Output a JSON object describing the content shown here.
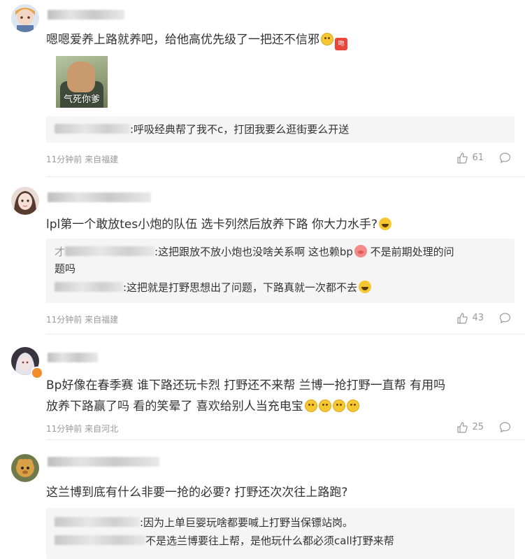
{
  "comments": [
    {
      "text": "嗯嗯爱养上路就养吧，给他高优先级了一把还不信邪",
      "sticker_caption": "气死你爹",
      "badge_emoji": "吻",
      "replies": [
        {
          "text": ":呼吸经典帮了我不c，打团我要么逛街要么开送"
        }
      ],
      "time": "11分钟前 来自福建",
      "likes": "61"
    },
    {
      "text": "lpl第一个敢放tes小炮的队伍 选卡列然后放养下路 你大力水手?",
      "replies": [
        {
          "prefix": "才",
          "text": ":这把跟放不放小炮也没啥关系啊 这也赖bp",
          "text_after": " 不是前期处理的问",
          "text_line2": "题吗"
        },
        {
          "text": ":这把就是打野思想出了问题，下路真就一次都不去"
        }
      ],
      "time": "11分钟前 来自福建",
      "likes": "43"
    },
    {
      "text_line1": "Bp好像在春季赛 谁下路还玩卡烈 打野还不来帮 兰博一抢打野一直帮 有用吗",
      "text_line2": "放养下路赢了吗 看的笑晕了 喜欢给别人当充电宝",
      "time": "11分钟前 来自河北",
      "likes": "25"
    },
    {
      "text": "这兰博到底有什么非要一抢的必要? 打野还次次往上路跑?",
      "replies": [
        {
          "text": ":因为上单巨婴玩啥都要喊上打野当保镖站岗。"
        },
        {
          "text": "不是选兰博要往上帮，是他玩什么都必须call打野来帮"
        }
      ]
    }
  ],
  "colors": {
    "text": "#333333",
    "meta": "#999999",
    "reply_bg": "#f5f5f5",
    "divider": "#ececec"
  }
}
